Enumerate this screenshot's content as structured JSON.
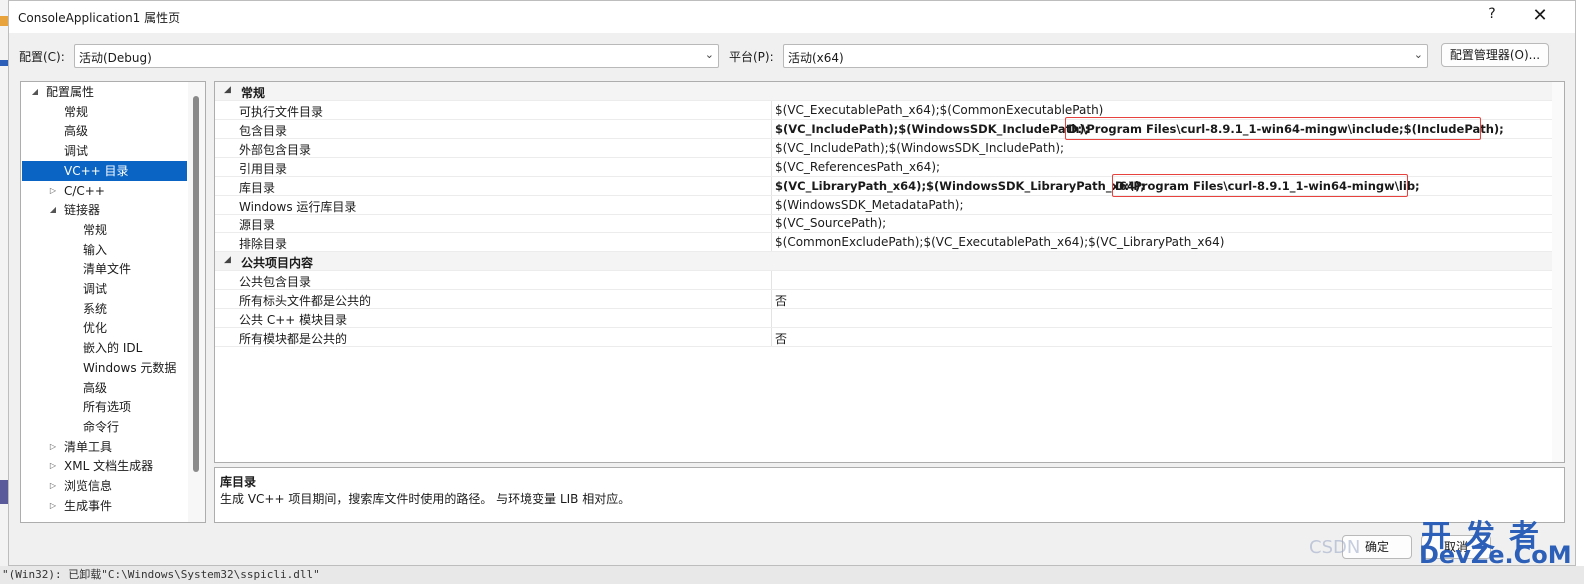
{
  "window": {
    "title": "ConsoleApplication1 属性页",
    "help": "?",
    "close": "✕"
  },
  "toolbar": {
    "config_label": "配置(C):",
    "config_value": "活动(Debug)",
    "platform_label": "平台(P):",
    "platform_value": "活动(x64)",
    "config_manager": "配置管理器(O)..."
  },
  "tree": {
    "items": [
      {
        "label": "配置属性",
        "expander": "◢"
      },
      {
        "label": "常规"
      },
      {
        "label": "高级"
      },
      {
        "label": "调试"
      },
      {
        "label": "VC++ 目录",
        "selected": true
      },
      {
        "label": "C/C++",
        "expander": "▷"
      },
      {
        "label": "链接器",
        "expander": "◢"
      },
      {
        "label": "常规"
      },
      {
        "label": "输入"
      },
      {
        "label": "清单文件"
      },
      {
        "label": "调试"
      },
      {
        "label": "系统"
      },
      {
        "label": "优化"
      },
      {
        "label": "嵌入的 IDL"
      },
      {
        "label": "Windows 元数据"
      },
      {
        "label": "高级"
      },
      {
        "label": "所有选项"
      },
      {
        "label": "命令行"
      },
      {
        "label": "清单工具",
        "expander": "▷"
      },
      {
        "label": "XML 文档生成器",
        "expander": "▷"
      },
      {
        "label": "浏览信息",
        "expander": "▷"
      },
      {
        "label": "生成事件",
        "expander": "▷"
      }
    ]
  },
  "grid": {
    "category_general": "常规",
    "category_public": "公共项目内容",
    "collapse_glyph": "◢",
    "rows": [
      {
        "name": "可执行文件目录",
        "value": "$(VC_ExecutablePath_x64);$(CommonExecutablePath)"
      },
      {
        "name": "包含目录",
        "value": "$(VC_IncludePath);$(WindowsSDK_IncludePath);",
        "extra": "D:\\Program Files\\curl-8.9.1_1-win64-mingw\\include;$(IncludePath);"
      },
      {
        "name": "外部包含目录",
        "value": "$(VC_IncludePath);$(WindowsSDK_IncludePath);"
      },
      {
        "name": "引用目录",
        "value": "$(VC_ReferencesPath_x64);"
      },
      {
        "name": "库目录",
        "value": "$(VC_LibraryPath_x64);$(WindowsSDK_LibraryPath_x64);",
        "extra": "D:\\Program Files\\curl-8.9.1_1-win64-mingw\\lib;"
      },
      {
        "name": "Windows 运行库目录",
        "value": "$(WindowsSDK_MetadataPath);"
      },
      {
        "name": "源目录",
        "value": "$(VC_SourcePath);"
      },
      {
        "name": "排除目录",
        "value": "$(CommonExcludePath);$(VC_ExecutablePath_x64);$(VC_LibraryPath_x64)"
      }
    ],
    "public_rows": [
      {
        "name": "公共包含目录",
        "value": ""
      },
      {
        "name": "所有标头文件都是公共的",
        "value": "否"
      },
      {
        "name": "公共 C++ 模块目录",
        "value": ""
      },
      {
        "name": "所有模块都是公共的",
        "value": "否"
      }
    ]
  },
  "description": {
    "title": "库目录",
    "text": "生成 VC++ 项目期间，搜索库文件时使用的路径。 与环境变量 LIB 相对应。"
  },
  "buttons": {
    "ok": "确定",
    "cancel": "取消"
  },
  "watermark": {
    "csdn": "CSDN",
    "brand_top": "开发者",
    "brand_bottom": "DevZe.CoM"
  },
  "ide_output": "\"(Win32): 已卸载\"C:\\Windows\\System32\\sspicli.dll\""
}
